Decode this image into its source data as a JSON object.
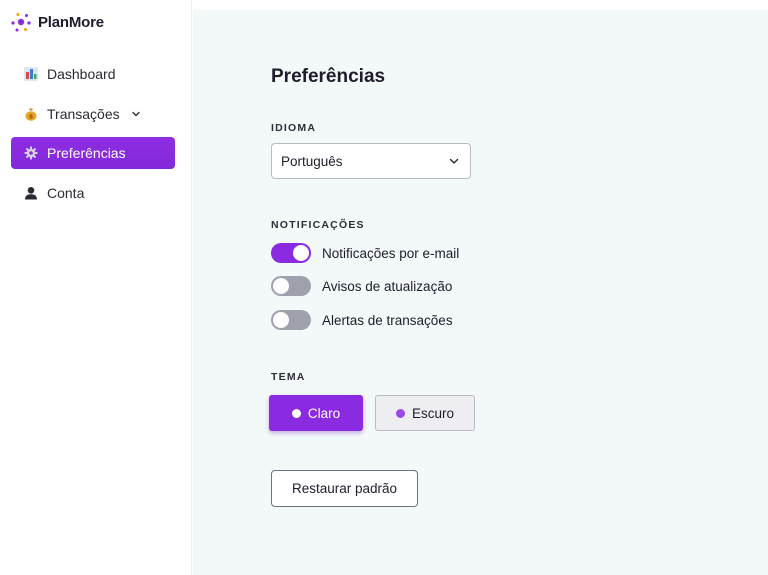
{
  "app": {
    "name": "PlanMore",
    "accent_color": "#8a2be2"
  },
  "sidebar": {
    "items": [
      {
        "label": "Dashboard",
        "icon": "bar-chart-icon",
        "active": false
      },
      {
        "label": "Transações",
        "icon": "money-bag-icon",
        "active": false,
        "expandable": true
      },
      {
        "label": "Preferências",
        "icon": "gear-icon",
        "active": true
      },
      {
        "label": "Conta",
        "icon": "user-icon",
        "active": false
      }
    ]
  },
  "main": {
    "title": "Preferências",
    "language": {
      "label": "IDIOMA",
      "selected": "Português"
    },
    "notifications": {
      "label": "NOTIFICAÇÕES",
      "items": [
        {
          "label": "Notificações por e-mail",
          "enabled": true
        },
        {
          "label": "Avisos de atualização",
          "enabled": false
        },
        {
          "label": "Alertas de transações",
          "enabled": false
        }
      ]
    },
    "theme": {
      "label": "TEMA",
      "options": [
        {
          "label": "Claro",
          "selected": true
        },
        {
          "label": "Escuro",
          "selected": false
        }
      ]
    },
    "reset_label": "Restaurar padrão"
  }
}
